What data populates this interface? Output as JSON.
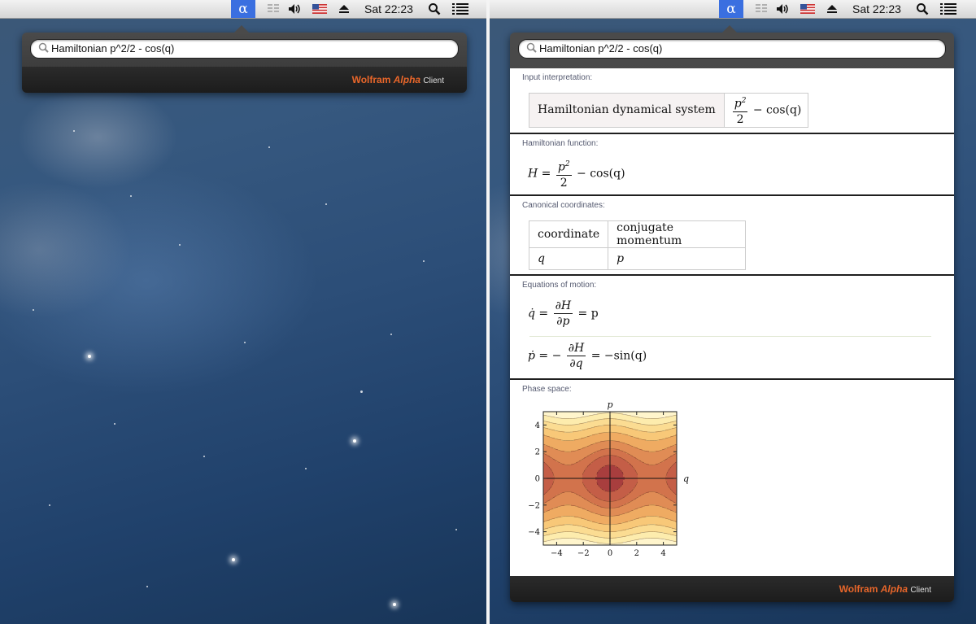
{
  "menubar": {
    "alpha_glyph": "α",
    "clock": "Sat 22:23",
    "icons": [
      "alpha-icon",
      "stacks-icon",
      "volume-icon",
      "us-flag-icon",
      "eject-icon",
      "spotlight-icon",
      "list-icon"
    ]
  },
  "search": {
    "query": "Hamiltonian p^2/2 - cos(q)"
  },
  "branding": {
    "wolfram": "Wolfram",
    "alpha": "Alpha",
    "client": "Client"
  },
  "pods": {
    "input_interpretation": {
      "title": "Input interpretation:",
      "label": "Hamiltonian dynamical system",
      "num": "p",
      "exp": "2",
      "den": "2",
      "rest": "− cos(q)"
    },
    "hamiltonian_function": {
      "title": "Hamiltonian function:",
      "lhs": "H",
      "eq": "=",
      "num": "p",
      "exp": "2",
      "den": "2",
      "rest": "− cos(q)"
    },
    "canonical_coordinates": {
      "title": "Canonical coordinates:",
      "headers": [
        "coordinate",
        "conjugate momentum"
      ],
      "row": [
        "q",
        "p"
      ]
    },
    "equations_of_motion": {
      "title": "Equations of motion:",
      "eq1": {
        "lhs": "q̇",
        "eq": "=",
        "num": "∂H",
        "den": "∂p",
        "rhs": "= p"
      },
      "eq2": {
        "lhs": "ṗ",
        "eq": "= −",
        "num": "∂H",
        "den": "∂q",
        "rhs": "= −sin(q)"
      }
    },
    "phase_space": {
      "title": "Phase space:",
      "x_axis_label": "q",
      "y_axis_label": "p",
      "x_ticks": [
        "−4",
        "−2",
        "0",
        "2",
        "4"
      ],
      "y_ticks": [
        "4",
        "2",
        "0",
        "−2",
        "−4"
      ]
    }
  },
  "chart_data": {
    "type": "heatmap",
    "function": "p^2/2 - cos(q)",
    "xlabel": "q",
    "ylabel": "p",
    "xlim": [
      -5,
      5
    ],
    "ylim": [
      -5,
      5
    ],
    "x_ticks": [
      -4,
      -2,
      0,
      2,
      4
    ],
    "y_ticks": [
      -4,
      -2,
      0,
      2,
      4
    ],
    "contour_levels": [
      -0.5,
      0.5,
      1.5,
      3,
      5,
      7,
      9,
      11
    ],
    "colors": [
      "#a83e3e",
      "#c45e47",
      "#d2734c",
      "#e08c55",
      "#efab62",
      "#f8c878",
      "#fbdc92",
      "#fdecad",
      "#fff5cc"
    ],
    "grid": false
  }
}
